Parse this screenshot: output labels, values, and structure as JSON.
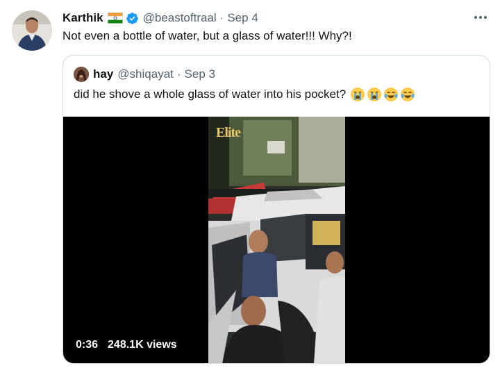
{
  "tweet": {
    "author_name": "Karthik",
    "author_handle": "@beastoftraal",
    "separator": "·",
    "date": "Sep 4",
    "text": "Not even a bottle of water, but a glass of water!!! Why?!",
    "flag_icon": "india-flag-icon",
    "verified_icon": "verified-badge-icon",
    "more_icon": "more-options-icon"
  },
  "quoted": {
    "author_name": "hay",
    "author_handle": "@shiqayat",
    "separator": "·",
    "date": "Sep 3",
    "text": "did he shove a whole glass of water into his pocket?",
    "emojis": [
      "loudly-crying-face",
      "loudly-crying-face",
      "tears-of-joy",
      "tears-of-joy"
    ]
  },
  "video": {
    "duration": "0:36",
    "views": "248.1K views",
    "watermark": "Elite"
  },
  "colors": {
    "text": "#0f1419",
    "secondary": "#536471",
    "verified": "#1d9bf0",
    "border": "#cfd9de"
  }
}
